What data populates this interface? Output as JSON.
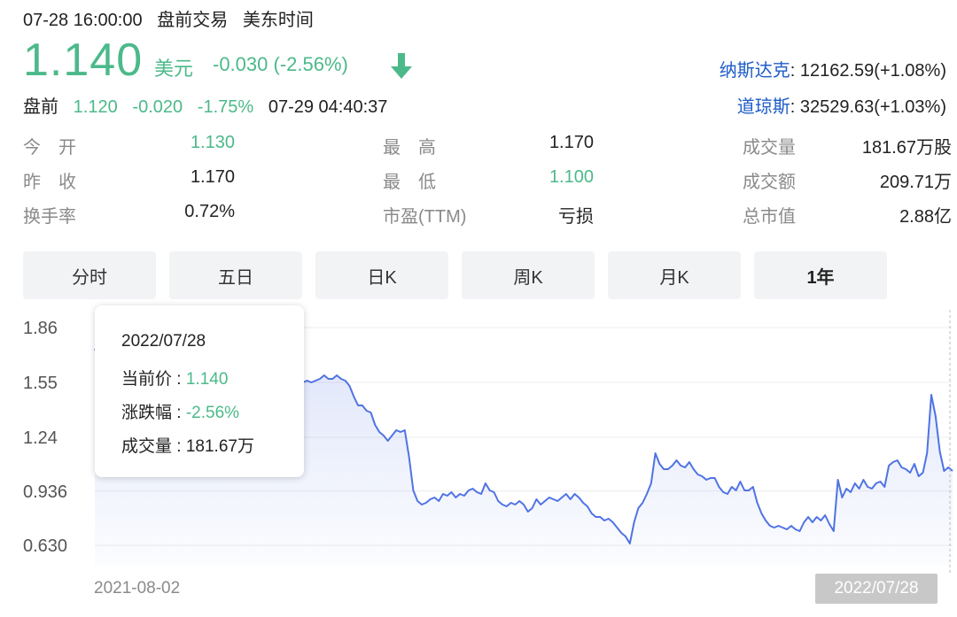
{
  "header": {
    "datetime": "07-28 16:00:00",
    "session": "盘前交易",
    "timezone": "美东时间",
    "price": "1.140",
    "currency": "美元",
    "change": "-0.030 (-2.56%)",
    "trend_icon": "down-arrow-icon"
  },
  "premarket": {
    "label": "盘前",
    "price": "1.120",
    "change": "-0.020",
    "pct": "-1.75%",
    "time": "07-29 04:40:37"
  },
  "indices": [
    {
      "name": "纳斯达克",
      "value": ": 12162.59(+1.08%)"
    },
    {
      "name": "道琼斯",
      "value": ": 32529.63(+1.03%)"
    }
  ],
  "stats": {
    "open": {
      "label": "今　开",
      "value": "1.130"
    },
    "prev_close": {
      "label": "昨　收",
      "value": "1.170"
    },
    "turnover_rate": {
      "label": "换手率",
      "value": "0.72%"
    },
    "high": {
      "label": "最　高",
      "value": "1.170"
    },
    "low": {
      "label": "最　低",
      "value": "1.100"
    },
    "pe": {
      "label": "市盈(TTM)",
      "value": "亏损"
    },
    "volume": {
      "label": "成交量",
      "value": "181.67万股"
    },
    "amount": {
      "label": "成交额",
      "value": "209.71万"
    },
    "market_cap": {
      "label": "总市值",
      "value": "2.88亿"
    }
  },
  "tabs": [
    {
      "label": "分时",
      "active": false
    },
    {
      "label": "五日",
      "active": false
    },
    {
      "label": "日K",
      "active": false
    },
    {
      "label": "周K",
      "active": false
    },
    {
      "label": "月K",
      "active": false
    },
    {
      "label": "1年",
      "active": true
    }
  ],
  "tooltip": {
    "date": "2022/07/28",
    "price_label": "当前价 : ",
    "price": "1.140",
    "change_label": "涨跌幅 : ",
    "change": "-2.56%",
    "volume_label": "成交量 : ",
    "volume": "181.67万"
  },
  "colors": {
    "up_down_green": "#4cb98a",
    "index_blue": "#1f5dc8",
    "line_blue": "#4f73e3"
  },
  "chart_data": {
    "type": "area",
    "y_ticks": [
      "1.86",
      "1.55",
      "1.24",
      "0.936",
      "0.630"
    ],
    "ylim": [
      0.63,
      1.86
    ],
    "x_start_label": "2021-08-02",
    "x_end_label": "2022/07/28",
    "grid": true,
    "series": [
      {
        "values": [
          1.74,
          1.68,
          1.63,
          1.6,
          1.58,
          1.59,
          1.57,
          1.6,
          1.56,
          1.58,
          1.57,
          1.6,
          1.59,
          1.61,
          1.58,
          1.6,
          1.58,
          1.57,
          1.6,
          1.59,
          1.57,
          1.59,
          1.58,
          1.6,
          1.61,
          1.6,
          1.58,
          1.59,
          1.6,
          1.58,
          1.59,
          1.61,
          1.6,
          1.59,
          1.58,
          1.58,
          1.57,
          1.59,
          1.58,
          1.56,
          1.58,
          1.59,
          1.58,
          1.61,
          1.6,
          1.56,
          1.55,
          1.55,
          1.58,
          1.55,
          1.56,
          1.55,
          1.56,
          1.57,
          1.59,
          1.57,
          1.57,
          1.59,
          1.57,
          1.56,
          1.53,
          1.47,
          1.42,
          1.42,
          1.39,
          1.38,
          1.31,
          1.27,
          1.25,
          1.22,
          1.25,
          1.28,
          1.27,
          1.28,
          1.13,
          0.94,
          0.88,
          0.86,
          0.87,
          0.89,
          0.9,
          0.88,
          0.92,
          0.91,
          0.93,
          0.9,
          0.92,
          0.91,
          0.94,
          0.95,
          0.93,
          0.92,
          0.98,
          0.94,
          0.93,
          0.88,
          0.86,
          0.85,
          0.87,
          0.86,
          0.88,
          0.86,
          0.82,
          0.84,
          0.89,
          0.86,
          0.88,
          0.9,
          0.89,
          0.88,
          0.9,
          0.92,
          0.89,
          0.92,
          0.9,
          0.87,
          0.85,
          0.81,
          0.79,
          0.79,
          0.77,
          0.78,
          0.76,
          0.73,
          0.7,
          0.68,
          0.64,
          0.76,
          0.84,
          0.87,
          0.92,
          0.98,
          1.15,
          1.09,
          1.06,
          1.06,
          1.08,
          1.11,
          1.08,
          1.07,
          1.1,
          1.06,
          1.03,
          1.02,
          1.0,
          1.01,
          1.01,
          0.96,
          0.93,
          0.92,
          0.96,
          0.94,
          0.99,
          0.94,
          0.94,
          0.96,
          0.87,
          0.81,
          0.77,
          0.74,
          0.73,
          0.74,
          0.73,
          0.72,
          0.74,
          0.72,
          0.71,
          0.76,
          0.79,
          0.76,
          0.79,
          0.77,
          0.8,
          0.75,
          0.71,
          1.0,
          0.9,
          0.95,
          0.93,
          0.98,
          0.95,
          1.0,
          0.96,
          0.95,
          0.98,
          0.99,
          0.96,
          1.08,
          1.1,
          1.11,
          1.07,
          1.06,
          1.04,
          1.09,
          1.02,
          1.04,
          1.15,
          1.48,
          1.36,
          1.16,
          1.05,
          1.07,
          1.05
        ]
      }
    ]
  }
}
